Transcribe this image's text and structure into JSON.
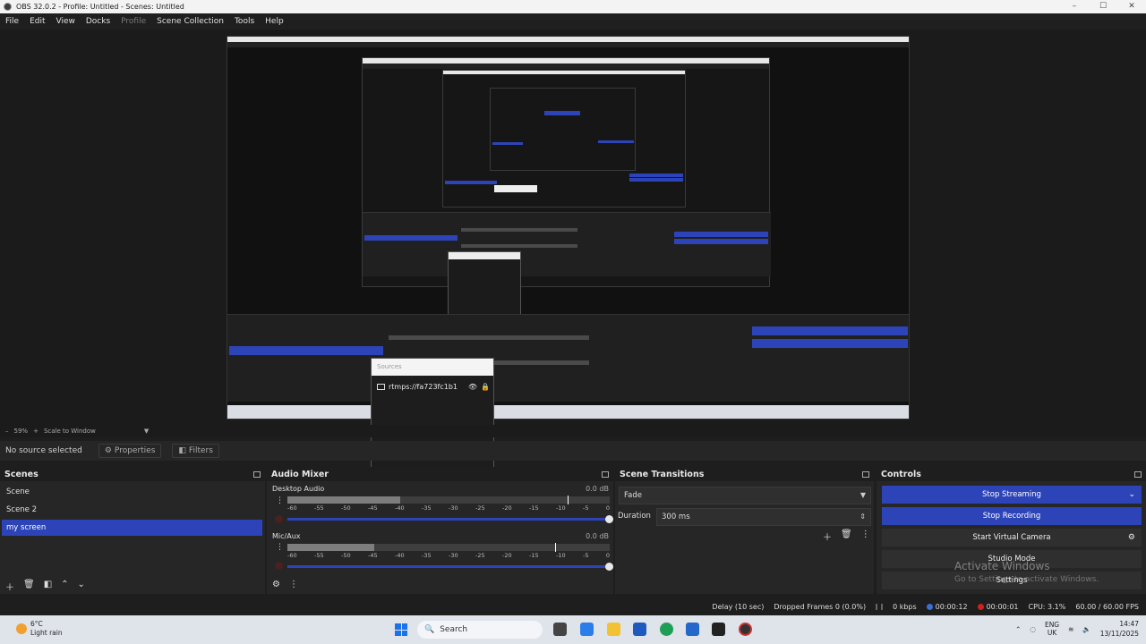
{
  "window": {
    "title": "OBS 32.0.2 - Profile: Untitled - Scenes: Untitled",
    "controls": [
      "–",
      "☐",
      "✕"
    ]
  },
  "menu": {
    "items": [
      "File",
      "Edit",
      "View",
      "Docks",
      "Profile",
      "Scene Collection",
      "Tools",
      "Help"
    ]
  },
  "sources_popup": {
    "header": "Sources",
    "item": "rtmps://fa723fc1b1"
  },
  "zoom": {
    "minus": "–",
    "value": "59%",
    "plus": "+",
    "mode": "Scale to Window"
  },
  "source_toolbar": {
    "no_source": "No source selected",
    "properties": "Properties",
    "filters": "Filters"
  },
  "scenes": {
    "title": "Scenes",
    "items": [
      "Scene",
      "Scene 2",
      "my screen"
    ]
  },
  "mixer": {
    "title": "Audio Mixer",
    "scale": [
      "-60",
      "-55",
      "-50",
      "-45",
      "-40",
      "-35",
      "-30",
      "-25",
      "-20",
      "-15",
      "-10",
      "-5",
      "0"
    ],
    "channels": [
      {
        "name": "Desktop Audio",
        "db": "0.0 dB",
        "level": 0.35,
        "peak": 0.87
      },
      {
        "name": "Mic/Aux",
        "db": "0.0 dB",
        "level": 0.27,
        "peak": 0.83
      }
    ]
  },
  "transitions": {
    "title": "Scene Transitions",
    "selected": "Fade",
    "duration_label": "Duration",
    "duration_value": "300 ms"
  },
  "controls": {
    "title": "Controls",
    "stop_streaming": "Stop Streaming",
    "stop_recording": "Stop Recording",
    "virtual_camera": "Start Virtual Camera",
    "studio_mode": "Studio Mode",
    "settings": "Settings"
  },
  "watermark": {
    "line1": "Activate Windows",
    "line2": "Go to Settings to activate Windows."
  },
  "status": {
    "delay": "Delay (10 sec)",
    "dropped": "Dropped Frames 0 (0.0%)",
    "kbps": "0 kbps",
    "stream_time": "00:00:12",
    "rec_time": "00:00:01",
    "cpu": "CPU: 3.1%",
    "fps": "60.00 / 60.00 FPS"
  },
  "taskbar": {
    "weather_temp": "6°C",
    "weather_cond": "Light rain",
    "search": "Search",
    "lang1": "ENG",
    "lang2": "UK",
    "time": "14:47",
    "date": "13/11/2025"
  },
  "colors": {
    "accent": "#2d44b8",
    "panel": "#262626",
    "record": "#d02020"
  }
}
